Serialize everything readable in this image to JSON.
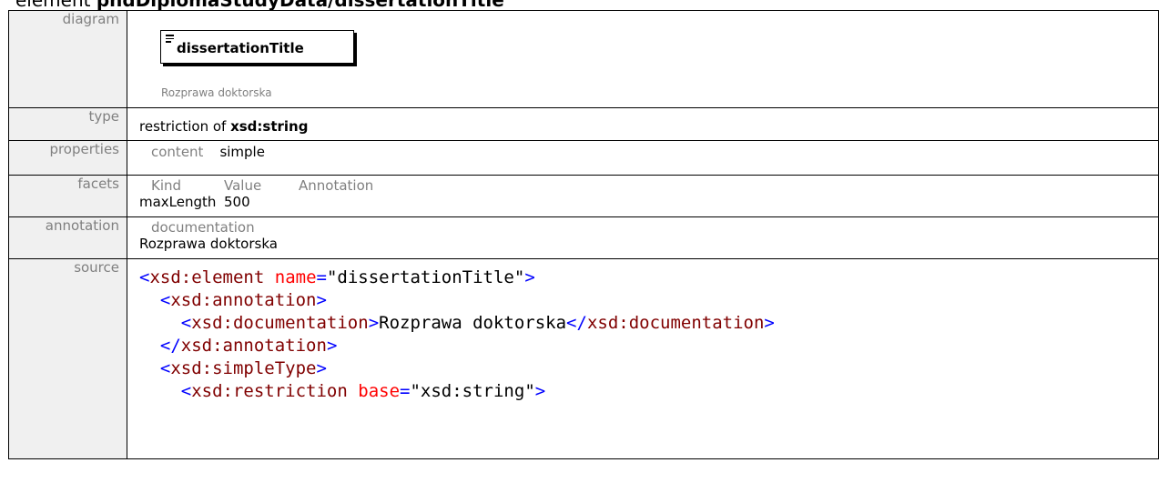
{
  "header": {
    "prefix": "element ",
    "path": "phdDiplomaStudyData/dissertationTitle"
  },
  "rows": {
    "diagram": {
      "label": "diagram",
      "element_name": "dissertationTitle",
      "element_doc": "Rozprawa doktorska"
    },
    "type": {
      "label": "type",
      "prefix": "restriction of ",
      "base": "xsd:string"
    },
    "properties": {
      "label": "properties",
      "key": "content",
      "value": "simple"
    },
    "facets": {
      "label": "facets",
      "headers": [
        "Kind",
        "Value",
        "Annotation"
      ],
      "rows": [
        {
          "kind": "maxLength",
          "value": "500",
          "annotation": ""
        }
      ]
    },
    "annotation": {
      "label": "annotation",
      "head": "documentation",
      "text": "Rozprawa doktorska"
    },
    "source": {
      "label": "source",
      "lines": [
        {
          "indent": "",
          "open": "<",
          "tag": "xsd:element",
          "attr": "name",
          "eq": "=",
          "val": "\"dissertationTitle\"",
          "close": ">",
          "text": ""
        },
        {
          "indent": "  ",
          "open": "<",
          "tag": "xsd:annotation",
          "close": ">"
        },
        {
          "indent": "    ",
          "open": "<",
          "tag": "xsd:documentation",
          "close": ">",
          "text": "Rozprawa doktorska",
          "endopen": "</",
          "endtag": "xsd:documentation",
          "endclose": ">"
        },
        {
          "indent": "  ",
          "open": "</",
          "tag": "xsd:annotation",
          "close": ">"
        },
        {
          "indent": "  ",
          "open": "<",
          "tag": "xsd:simpleType",
          "close": ">"
        },
        {
          "indent": "    ",
          "open": "<",
          "tag": "xsd:restriction",
          "attr": "base",
          "eq": "=",
          "val": "\"xsd:string\"",
          "close": ">"
        }
      ]
    }
  }
}
